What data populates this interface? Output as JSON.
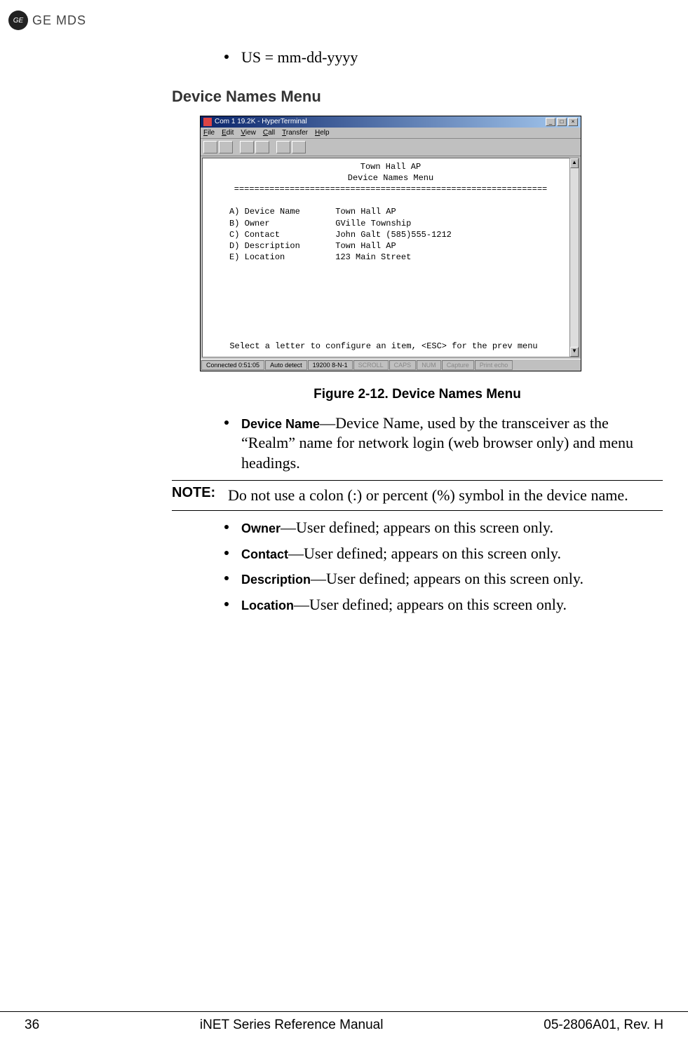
{
  "logo": {
    "ge": "GE",
    "mds": "GE MDS"
  },
  "top_bullet": "US = mm-dd-yyyy",
  "section_heading": "Device Names Menu",
  "hyperterminal": {
    "title": "Com 1 19.2K - HyperTerminal",
    "menus": [
      "File",
      "Edit",
      "View",
      "Call",
      "Transfer",
      "Help"
    ],
    "header1": "Town Hall AP",
    "header2": "Device Names Menu",
    "divider": "==============================================================",
    "rows": [
      {
        "k": "A) Device Name",
        "v": "Town Hall AP"
      },
      {
        "k": "B) Owner",
        "v": "GVille Township"
      },
      {
        "k": "C) Contact",
        "v": "John Galt (585)555-1212"
      },
      {
        "k": "D) Description",
        "v": "Town Hall AP"
      },
      {
        "k": "E) Location",
        "v": "123 Main Street"
      }
    ],
    "prompt": "Select a letter to configure an item, <ESC> for the prev menu",
    "status": {
      "conn": "Connected 0:51:05",
      "detect": "Auto detect",
      "setting": "19200 8-N-1",
      "dim": [
        "SCROLL",
        "CAPS",
        "NUM",
        "Capture",
        "Print echo"
      ]
    }
  },
  "figure_caption": "Figure 2-12. Device Names Menu",
  "def_bullets": [
    {
      "t": "Device Name",
      "d": "—Device Name, used by the transceiver as the “Realm” name for network login (web browser only) and menu headings."
    }
  ],
  "note": {
    "label": "NOTE:",
    "text": "Do not use a colon (:) or percent (%) symbol in the device name."
  },
  "def_bullets2": [
    {
      "t": "Owner",
      "d": "—User defined; appears on this screen only."
    },
    {
      "t": "Contact",
      "d": "—User defined; appears on this screen only."
    },
    {
      "t": "Description",
      "d": "—User defined; appears on this screen only."
    },
    {
      "t": "Location",
      "d": "—User defined; appears on this screen only."
    }
  ],
  "footer": {
    "page": "36",
    "title": "iNET Series Reference Manual",
    "doc": "05-2806A01, Rev. H"
  }
}
